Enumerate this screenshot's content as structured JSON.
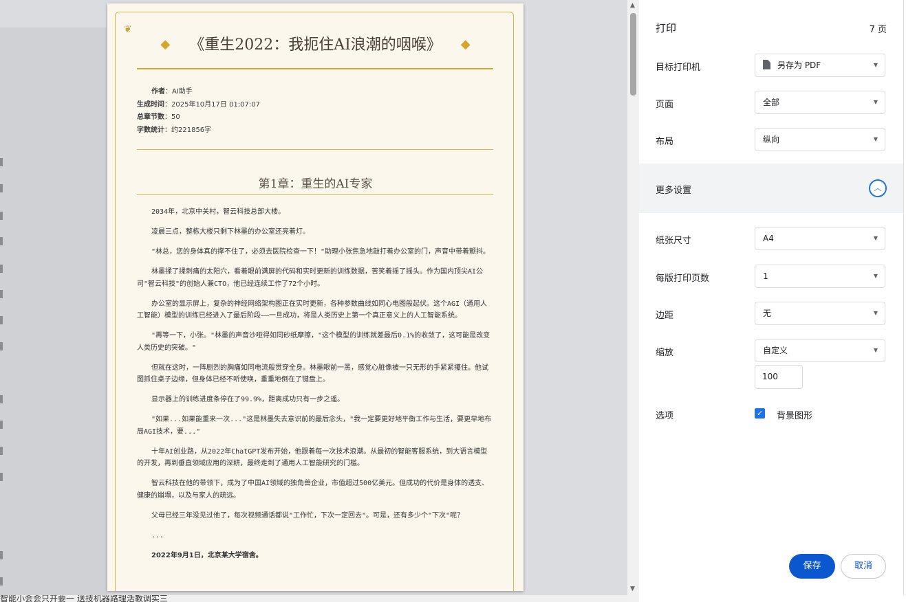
{
  "background": {
    "bottom_text": "智能小会会只开要一 送技机器路理活教调实三"
  },
  "document": {
    "title": "《重生2022：我扼住AI浪潮的咽喉》",
    "meta": [
      {
        "key": "作者",
        "value": "AI助手"
      },
      {
        "key": "生成时间",
        "value": "2025年10月17日 01:07:07"
      },
      {
        "key": "总章节数",
        "value": "50"
      },
      {
        "key": "字数统计",
        "value": "约221856字"
      }
    ],
    "chapter_title": "第1章：重生的AI专家",
    "paragraphs": [
      "2034年，北京中关村，智云科技总部大楼。",
      "凌晨三点，整栋大楼只剩下林墨的办公室还亮着灯。",
      "\"林总，您的身体真的撑不住了，必须去医院检查一下！\"助理小张焦急地敲打着办公室的门，声音中带着颤抖。",
      "林墨揉了揉刺痛的太阳穴，看着眼前满屏的代码和实时更新的训练数据，苦笑着摇了摇头。作为国内顶尖AI公司\"智云科技\"的创始人兼CTO，他已经连续工作了72个小时。",
      "办公室的显示屏上，复杂的神经网络架构图正在实时更新，各种参数曲线如同心电图般起伏。这个AGI（通用人工智能）模型的训练已经进入了最后阶段——一旦成功，将是人类历史上第一个真正意义上的人工智能系统。",
      "\"再等一下，小张。\"林墨的声音沙哑得如同砂纸摩擦，\"这个模型的训练就差最后0.1%的收敛了，这可能是改变人类历史的突破。\"",
      "但就在这时，一阵剧烈的胸痛如同电流般贯穿全身。林墨眼前一黑，感觉心脏像被一只无形的手紧紧攥住。他试图抓住桌子边缘，但身体已经不听使唤，重重地倒在了键盘上。",
      "显示器上的训练进度条停在了99.9%，距离成功只有一步之遥。",
      "\"如果...如果能重来一次...\"这是林墨失去意识前的最后念头，\"我一定要更好地平衡工作与生活，要更早地布局AGI技术，要...\"",
      "十年AI创业路，从2022年ChatGPT发布开始，他跟着每一次技术浪潮。从最初的智能客服系统，到大语言模型的开发，再到垂直领域应用的深耕，最终走到了通用人工智能研究的门槛。",
      "智云科技在他的带领下，成为了中国AI领域的独角兽企业，市值超过500亿美元。但成功的代价是身体的透支、健康的崩塌，以及与家人的疏远。",
      "父母已经三年没见过他了，每次视频通话都说\"工作忙，下次一定回去\"。可是，还有多少个\"下次\"呢？",
      "..."
    ],
    "last_line": "2022年9月1日，北京某大学宿舍。"
  },
  "print_panel": {
    "title": "打印",
    "page_count": "7 页",
    "destination": {
      "label": "目标打印机",
      "value": "另存为 PDF"
    },
    "pages": {
      "label": "页面",
      "value": "全部"
    },
    "layout": {
      "label": "布局",
      "value": "纵向"
    },
    "more_settings": {
      "label": "更多设置"
    },
    "paper_size": {
      "label": "纸张尺寸",
      "value": "A4"
    },
    "pages_per_sheet": {
      "label": "每版打印页数",
      "value": "1"
    },
    "margins": {
      "label": "边距",
      "value": "无"
    },
    "scale": {
      "label": "缩放",
      "value": "自定义",
      "custom_value": "100"
    },
    "options": {
      "label": "选项",
      "checkbox_label": "背景图形",
      "checked": true
    },
    "save_label": "保存",
    "cancel_label": "取消"
  },
  "colors": {
    "accent": "#1a73e8",
    "save_button": "#0b57d0",
    "page_bg": "#fbf7ec",
    "gold": "#d4a72c"
  }
}
